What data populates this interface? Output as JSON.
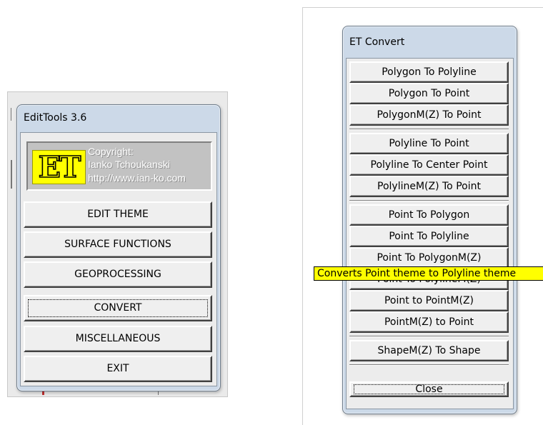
{
  "edittools": {
    "title": "EditTools 3.6",
    "logo": {
      "mark": "ET",
      "copyright": "Copyright:",
      "author": "Ianko Tchoukanski",
      "url": "http://www.ian-ko.com"
    },
    "buttons": [
      {
        "label": "EDIT THEME"
      },
      {
        "label": "SURFACE FUNCTIONS"
      },
      {
        "label": "GEOPROCESSING"
      },
      {
        "label": "CONVERT"
      },
      {
        "label": "MISCELLANEOUS"
      },
      {
        "label": "EXIT"
      }
    ]
  },
  "convert": {
    "title": "ET Convert",
    "buttons": [
      {
        "label": "Polygon To Polyline"
      },
      {
        "label": "Polygon To Point"
      },
      {
        "label": "PolygonM(Z) To Point"
      },
      {
        "label": "Polyline To Point"
      },
      {
        "label": "Polyline To Center Point"
      },
      {
        "label": "PolylineM(Z) To Point"
      },
      {
        "label": "Point To Polygon"
      },
      {
        "label": "Point To Polyline"
      },
      {
        "label": "Point To PolygonM(Z)"
      },
      {
        "label": "Point To PolylineM(Z)"
      },
      {
        "label": "Point to PointM(Z)"
      },
      {
        "label": "PointM(Z) to Point"
      },
      {
        "label": "ShapeM(Z) To Shape"
      }
    ],
    "close_label": "Close"
  },
  "tooltip": "Converts Point theme to Polyline theme",
  "colors": {
    "dialog_frame": "#ccd9e8",
    "client": "#ececec",
    "logo_bg": "#c2c2c2",
    "logo_mark": "#ffff00",
    "tooltip_bg": "#ffff00"
  }
}
